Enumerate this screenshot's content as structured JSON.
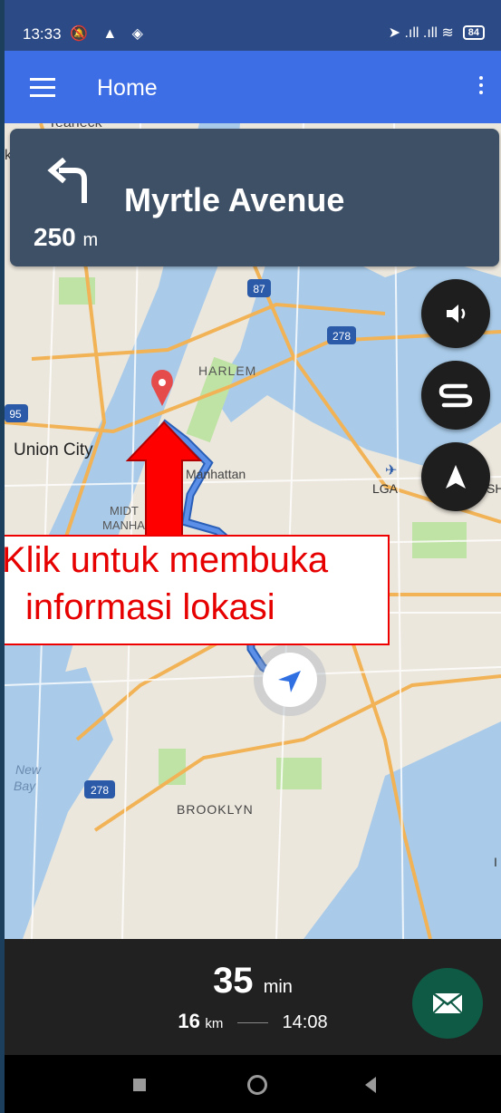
{
  "status_bar": {
    "time": "13:33",
    "left_icons": "🔕 ▲ ◈",
    "right_icons": "➤ .ıll .ıll ≋",
    "battery": "84"
  },
  "app_bar": {
    "title": "Home",
    "menu_icon": "hamburger-icon",
    "overflow_icon": "more-vert-icon"
  },
  "navigation": {
    "turn_direction": "turn-left-icon",
    "street": "Myrtle Avenue",
    "distance_value": "250",
    "distance_unit": "m"
  },
  "map": {
    "labels": {
      "teaneck": "Teaneck",
      "harlem": "HARLEM",
      "union_city": "Union City",
      "manhattan": "Manhattan",
      "midtown": "MIDT",
      "manhattan2": "MANHA",
      "lga": "LGA",
      "brooklyn": "BROOKLYN",
      "new_bay": "New",
      "bay": "Bay",
      "edge_k": "k",
      "edge_sh": "SH",
      "edge_i": "I"
    },
    "shields": {
      "i87": "87",
      "i278a": "278",
      "i95": "95",
      "i278b": "278"
    }
  },
  "annotation": {
    "line1": "Klik untuk membuka",
    "line2": "informasi lokasi",
    "color": "#e60000"
  },
  "fabs": {
    "sound": "volume-icon",
    "route": "route-icon",
    "compass": "navigation-arrow-icon"
  },
  "eta": {
    "minutes": "35",
    "minutes_unit": "min",
    "distance": "16",
    "distance_unit": "km",
    "arrival": "14:08"
  },
  "message_fab": "mail-icon",
  "colors": {
    "app_bar": "#3d6ee6",
    "status_bar": "#2c4b86",
    "card": "#3e5066",
    "route": "#4a7fd6"
  }
}
